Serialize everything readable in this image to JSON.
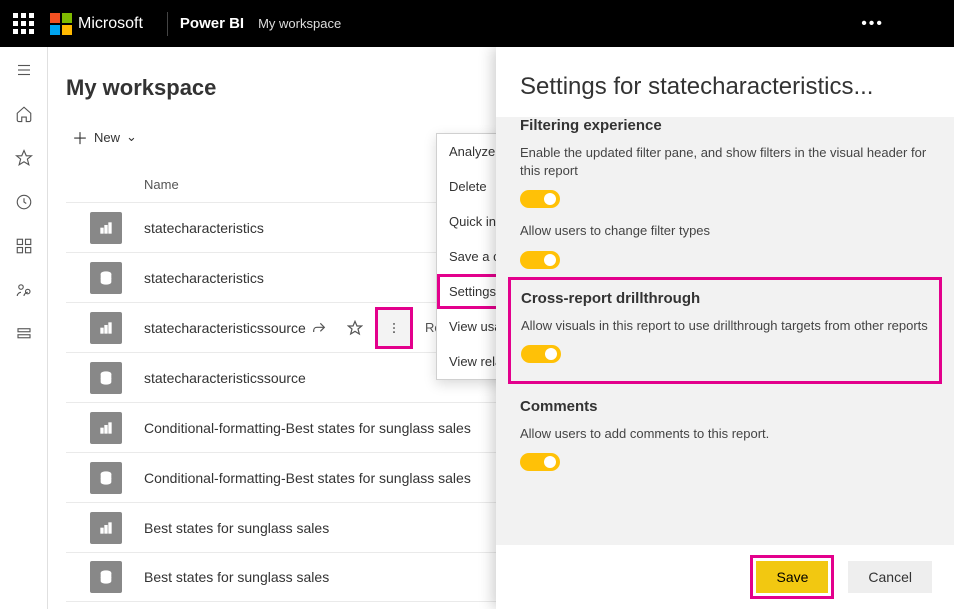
{
  "header": {
    "brand": "Microsoft",
    "app": "Power BI",
    "workspace": "My workspace"
  },
  "page": {
    "title": "My workspace",
    "new_label": "New",
    "column_name": "Name"
  },
  "items": [
    {
      "name": "statecharacteristics",
      "kind": "report"
    },
    {
      "name": "statecharacteristics",
      "kind": "dataset"
    },
    {
      "name": "statecharacteristicssource",
      "kind": "report",
      "hovered": true,
      "type_label": "Report"
    },
    {
      "name": "statecharacteristicssource",
      "kind": "dataset"
    },
    {
      "name": "Conditional-formatting-Best states for sunglass sales",
      "kind": "report"
    },
    {
      "name": "Conditional-formatting-Best states for sunglass sales",
      "kind": "dataset"
    },
    {
      "name": "Best states for sunglass sales",
      "kind": "report"
    },
    {
      "name": "Best states for sunglass sales",
      "kind": "dataset"
    }
  ],
  "context_menu": {
    "items": [
      "Analyze in Excel",
      "Delete",
      "Quick insights",
      "Save a copy",
      "Settings",
      "View usage metrics",
      "View related"
    ],
    "highlighted_index": 4
  },
  "settings_panel": {
    "title": "Settings for statecharacteristics...",
    "sections": {
      "filtering": {
        "heading": "Filtering experience",
        "opt1": "Enable the updated filter pane, and show filters in the visual header for this report",
        "opt2": "Allow users to change filter types"
      },
      "drillthrough": {
        "heading": "Cross-report drillthrough",
        "desc": "Allow visuals in this report to use drillthrough targets from other reports"
      },
      "comments": {
        "heading": "Comments",
        "desc": "Allow users to add comments to this report."
      }
    },
    "save": "Save",
    "cancel": "Cancel",
    "toggles": {
      "filter_pane": true,
      "filter_types": true,
      "drillthrough": true,
      "comments": true
    }
  }
}
